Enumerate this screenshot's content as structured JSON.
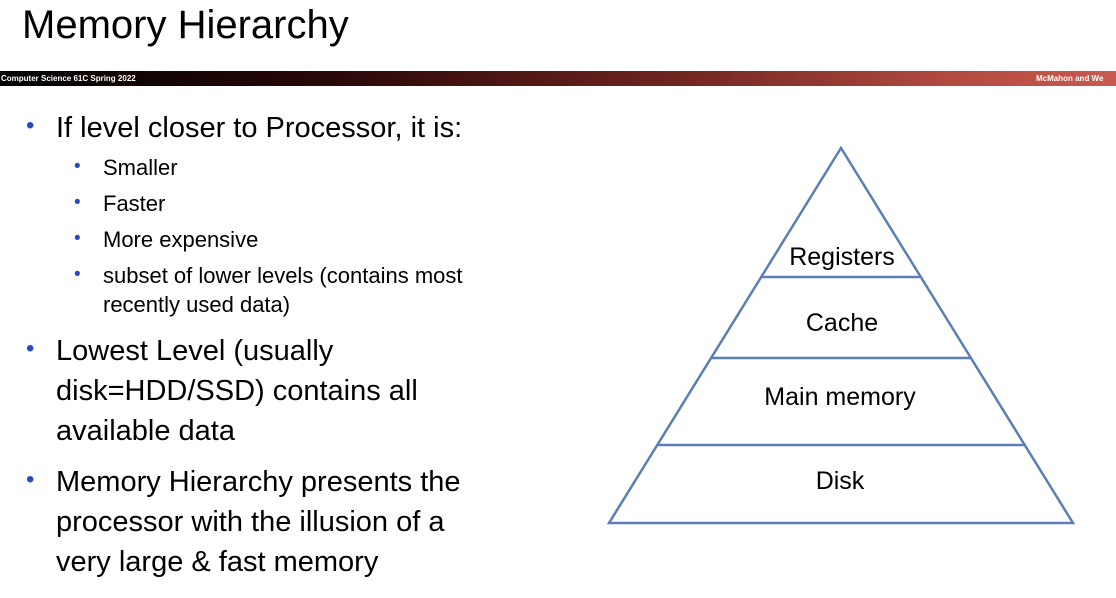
{
  "slide": {
    "title": "Memory Hierarchy",
    "footer_left": "Computer Science 61C Spring 2022",
    "footer_right": "McMahon and We"
  },
  "bullets": {
    "b1": "If level closer to Processor, it is:",
    "sub": [
      "Smaller",
      "Faster",
      "More expensive",
      "subset of lower levels (contains most",
      "recently used data)"
    ],
    "b2": [
      "Lowest Level (usually",
      "disk=HDD/SSD) contains all",
      "available data"
    ],
    "b3": [
      "Memory Hierarchy presents the",
      "processor with the illusion of a",
      "very large & fast memory"
    ]
  },
  "pyramid": {
    "levels": [
      "Registers",
      "Cache",
      "Main memory",
      "Disk"
    ],
    "line_color": "#5b7fb5"
  },
  "colors": {
    "bullet": "#2a49c6"
  }
}
